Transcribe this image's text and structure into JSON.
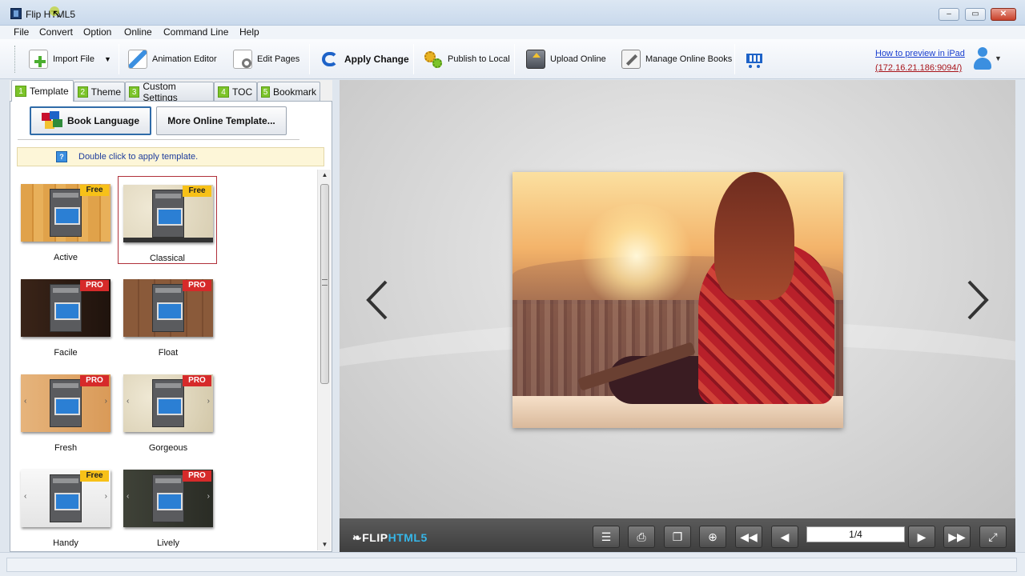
{
  "window": {
    "title": "Flip HTML5",
    "controls": {
      "minimize": "–",
      "maximize": "▭",
      "close": "✕"
    }
  },
  "menu": [
    "File",
    "Convert",
    "Option",
    "Online",
    "Command Line",
    "Help"
  ],
  "toolbar": {
    "import_file": "Import File",
    "animation_editor": "Animation Editor",
    "edit_pages": "Edit Pages",
    "apply_change": "Apply Change",
    "publish_local": "Publish to Local",
    "upload_online": "Upload Online",
    "manage_online": "Manage Online Books",
    "ipad_link_line1": "How to preview in iPad",
    "ipad_link_line2": "(172.16.21.186:9094/)"
  },
  "tabs": [
    {
      "num": "1",
      "label": "Template"
    },
    {
      "num": "2",
      "label": "Theme"
    },
    {
      "num": "3",
      "label": "Custom Settings"
    },
    {
      "num": "4",
      "label": "TOC"
    },
    {
      "num": "5",
      "label": "Bookmark"
    }
  ],
  "template_panel": {
    "book_language": "Book Language",
    "more_templates": "More Online Template...",
    "hint": "Double click to apply template.",
    "hint_icon": "?",
    "templates": [
      {
        "name": "Active",
        "badge": "Free"
      },
      {
        "name": "Classical",
        "badge": "Free"
      },
      {
        "name": "Facile",
        "badge": "PRO"
      },
      {
        "name": "Float",
        "badge": "PRO"
      },
      {
        "name": "Fresh",
        "badge": "PRO"
      },
      {
        "name": "Gorgeous",
        "badge": "PRO"
      },
      {
        "name": "Handy",
        "badge": "Free"
      },
      {
        "name": "Lively",
        "badge": "PRO"
      }
    ]
  },
  "preview": {
    "logo_flip": "FLIP",
    "logo_html5": "HTML5",
    "page_indicator": "1/4"
  },
  "colors": {
    "accent_blue": "#1a3fcf",
    "link_red": "#a8141a",
    "pro_red": "#d62a2a",
    "free_yellow": "#f7c118",
    "tab_green": "#7cc42a"
  }
}
